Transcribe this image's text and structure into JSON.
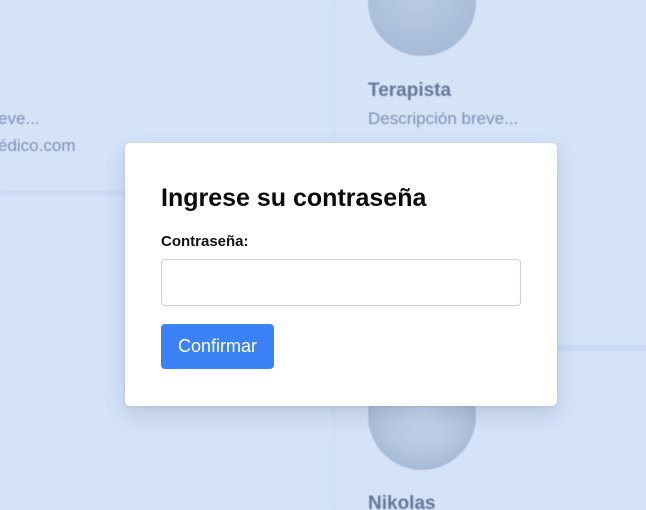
{
  "background": {
    "left_card": {
      "description_text": "eve...",
      "email_text": "édico.com"
    },
    "right_card_top": {
      "name": "Terapista",
      "description": "Descripción breve...",
      "email_partial": "..."
    },
    "right_card_bottom": {
      "name": "Nikolas"
    }
  },
  "modal": {
    "title": "Ingrese su contraseña",
    "password_label": "Contraseña:",
    "password_value": "",
    "password_placeholder": "",
    "confirm_label": "Confirmar"
  },
  "colors": {
    "accent": "#3b82f6",
    "overlay": "#dbe8fb"
  }
}
